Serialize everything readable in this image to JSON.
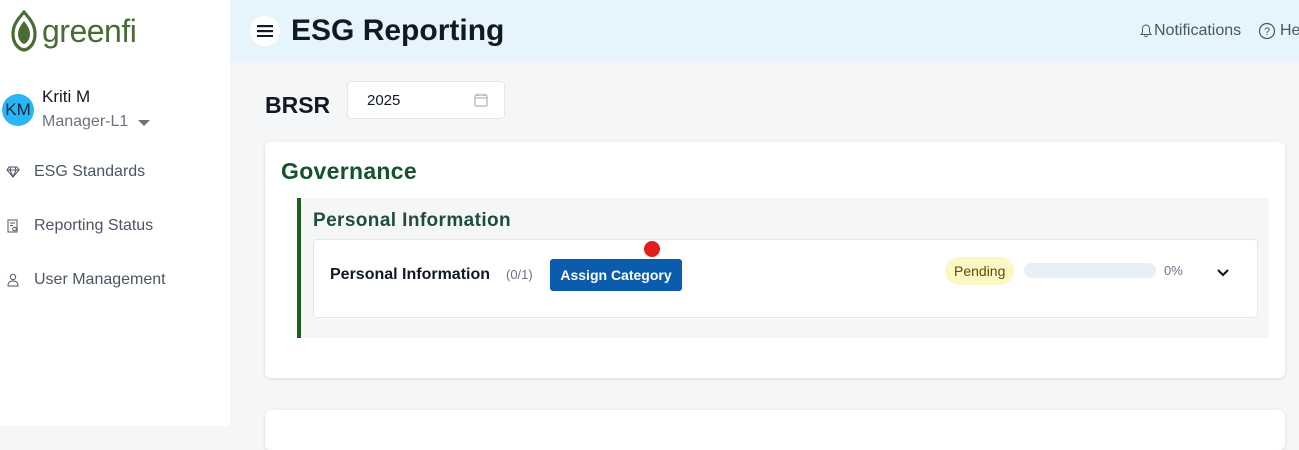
{
  "brand": {
    "name": "greenfi",
    "color": "#4a6b35"
  },
  "user": {
    "initials": "KM",
    "name": "Kriti M",
    "role": "Manager-L1"
  },
  "sidebar": {
    "items": [
      {
        "label": "ESG Standards",
        "icon": "diamond-icon"
      },
      {
        "label": "Reporting Status",
        "icon": "report-icon"
      },
      {
        "label": "User Management",
        "icon": "user-icon"
      }
    ]
  },
  "header": {
    "title": "ESG Reporting",
    "notifications_label": "Notifications",
    "help_label": "He"
  },
  "main": {
    "framework_label": "BRSR",
    "year_value": "2025",
    "card": {
      "title": "Governance",
      "section": {
        "title": "Personal Information",
        "item": {
          "title": "Personal Information",
          "count": "(0/1)",
          "assign_label": "Assign Category",
          "status": "Pending",
          "progress_percent": 0,
          "progress_text": "0%"
        }
      }
    }
  },
  "colors": {
    "header_bg": "#e6f4fc",
    "accent_green": "#1e5f1e",
    "primary_button": "#0b5cad",
    "pending_badge_bg": "#fdf7c3",
    "notification_dot": "#e11d1d"
  }
}
